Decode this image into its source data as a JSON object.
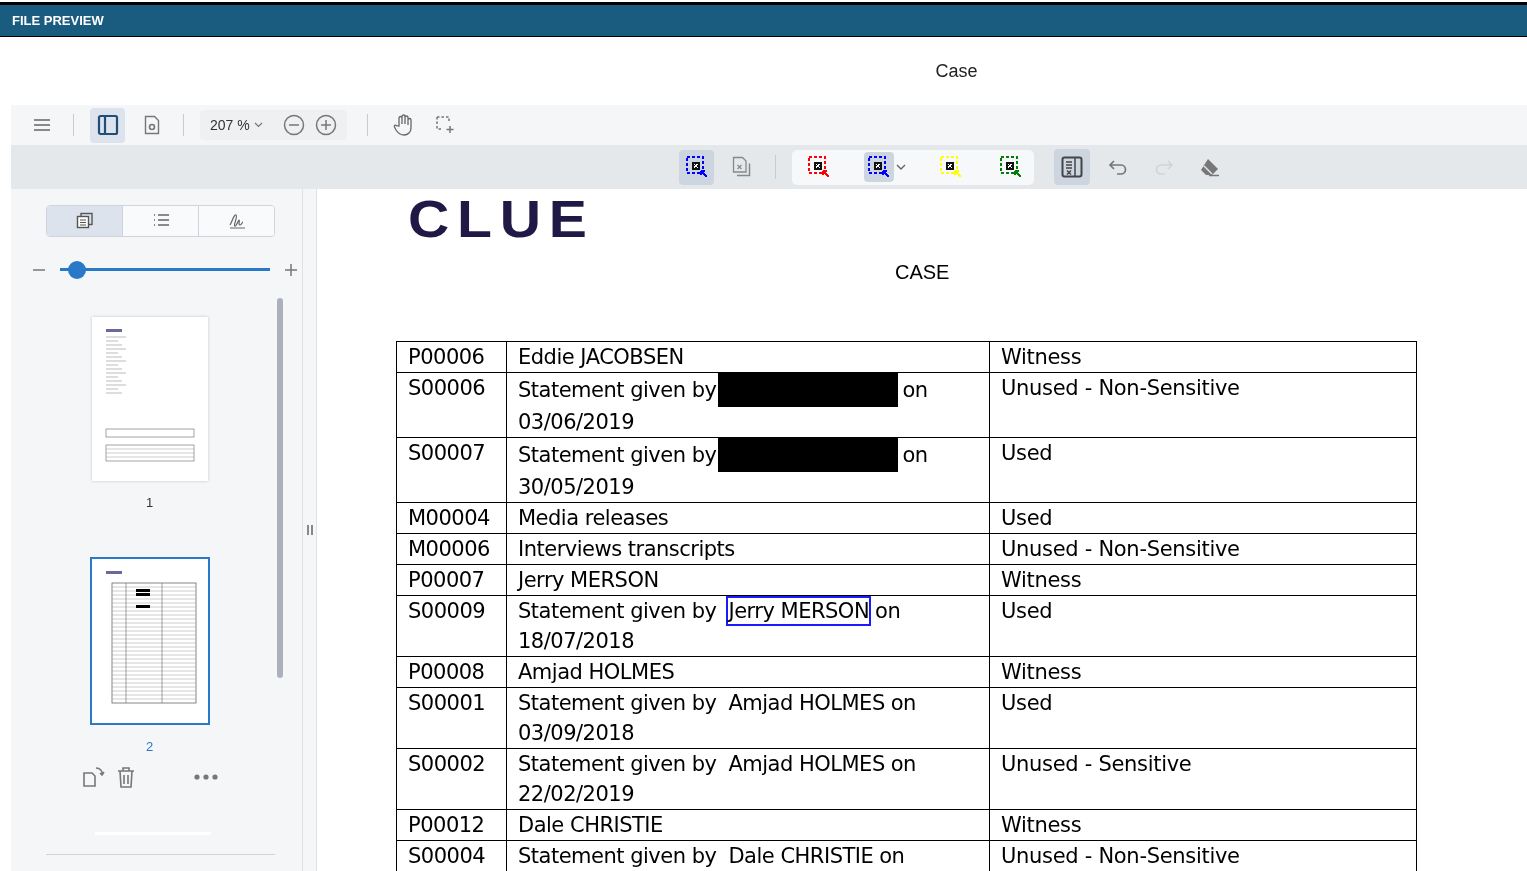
{
  "header": {
    "title": "FILE PREVIEW"
  },
  "document_title": "Case",
  "toolbar": {
    "sidebar_toggle_selected": true,
    "zoom": "207 %"
  },
  "redaction_toolbar": {
    "redact_tool_selected": true,
    "tools": [
      {
        "color": "#ff0000",
        "selected": false
      },
      {
        "color": "#0000ff",
        "selected": true
      },
      {
        "color": "#ffff00",
        "selected": false
      },
      {
        "color": "#008000",
        "selected": false
      }
    ],
    "panel_selected": true,
    "redo_disabled": true
  },
  "sidebar": {
    "tabs": [
      {
        "kind": "thumbnails",
        "selected": true
      },
      {
        "kind": "outline",
        "selected": false
      },
      {
        "kind": "signatures",
        "selected": false
      }
    ],
    "thumbnail_size": {
      "level": 0.08
    },
    "pages": [
      {
        "label": "1",
        "selected": false,
        "kind": "summary"
      },
      {
        "label": "2",
        "selected": true,
        "kind": "table"
      }
    ]
  },
  "document": {
    "logo": "CLUE",
    "heading": "CASE",
    "rows": [
      {
        "kind": "plain",
        "id": "P00006",
        "description": "Eddie JACOBSEN",
        "category": "Witness"
      },
      {
        "kind": "statement",
        "id": "S00006",
        "lead": "Statement given by",
        "redacted": true,
        "tail": "on",
        "date": "03/06/2019",
        "category": "Unused - Non-Sensitive"
      },
      {
        "kind": "statement",
        "id": "S00007",
        "lead": "Statement given by",
        "redacted": true,
        "tail": "on",
        "date": "30/05/2019",
        "category": "Used"
      },
      {
        "kind": "plain",
        "id": "M00004",
        "description": "Media releases",
        "category": "Used"
      },
      {
        "kind": "plain",
        "id": "M00006",
        "description": "Interviews transcripts",
        "category": "Unused - Non-Sensitive"
      },
      {
        "kind": "plain",
        "id": "P00007",
        "description": "Jerry MERSON",
        "category": "Witness"
      },
      {
        "kind": "statement",
        "id": "S00009",
        "lead": "Statement given by",
        "name": "Jerry MERSON",
        "redacted": false,
        "highlighted": true,
        "tail": "on",
        "date": "18/07/2018",
        "category": "Used"
      },
      {
        "kind": "plain",
        "id": "P00008",
        "description": "Amjad HOLMES",
        "category": "Witness"
      },
      {
        "kind": "statement",
        "id": "S00001",
        "lead": "Statement given by",
        "name": "Amjad HOLMES",
        "redacted": false,
        "highlighted": false,
        "tail": "on",
        "date": "03/09/2018",
        "category": "Used"
      },
      {
        "kind": "statement",
        "id": "S00002",
        "lead": "Statement given by",
        "name": "Amjad HOLMES",
        "redacted": false,
        "highlighted": false,
        "tail": "on",
        "date": "22/02/2019",
        "category": "Unused - Sensitive"
      },
      {
        "kind": "plain",
        "id": "P00012",
        "description": "Dale CHRISTIE",
        "category": "Witness"
      },
      {
        "kind": "statement",
        "id": "S00004",
        "lead": "Statement given by",
        "name": "Dale CHRISTIE",
        "redacted": false,
        "highlighted": false,
        "tail": "on",
        "category": "Unused - Non-Sensitive"
      }
    ]
  }
}
